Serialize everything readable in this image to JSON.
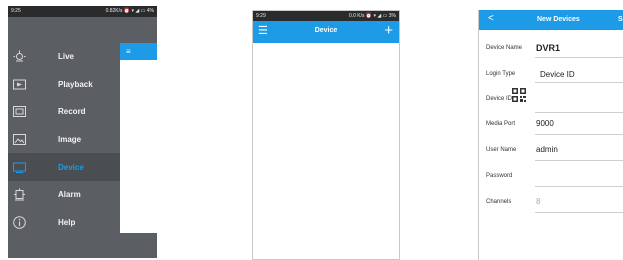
{
  "phone1": {
    "status_left": "9:25",
    "status_right": "0.82K/s ⏰ ▾ ◢ ▭ 4%",
    "menu": [
      {
        "label": "Live",
        "icon": "live-icon"
      },
      {
        "label": "Playback",
        "icon": "playback-icon"
      },
      {
        "label": "Record",
        "icon": "record-icon"
      },
      {
        "label": "Image",
        "icon": "image-icon"
      },
      {
        "label": "Device",
        "icon": "device-icon"
      },
      {
        "label": "Alarm",
        "icon": "alarm-icon"
      },
      {
        "label": "Help",
        "icon": "help-icon"
      }
    ],
    "active": "Device",
    "peek_menu_glyph": "≡"
  },
  "phone2": {
    "status_left": "9:29",
    "status_right": "0.0 K/s ⏰ ▾ ◢ ▭ 3%",
    "title": "Device",
    "menu_glyph": "☰",
    "add_glyph": "+"
  },
  "phone3": {
    "back_glyph": "<",
    "title": "New Devices",
    "save_label": "S",
    "fields": {
      "device_name": {
        "label": "Device Name",
        "value": "DVR1"
      },
      "login_type": {
        "label": "Login Type",
        "value": "Device ID"
      },
      "device_id": {
        "label": "Device ID",
        "value": ""
      },
      "media_port": {
        "label": "Media Port",
        "value": "9000"
      },
      "user_name": {
        "label": "User Name",
        "value": "admin"
      },
      "password": {
        "label": "Password",
        "value": ""
      },
      "channels": {
        "label": "Channels",
        "value": "8"
      }
    }
  },
  "colors": {
    "accent": "#1e9be7",
    "menu_bg": "#5b5e62",
    "status_bar": "#2a2b2d"
  }
}
